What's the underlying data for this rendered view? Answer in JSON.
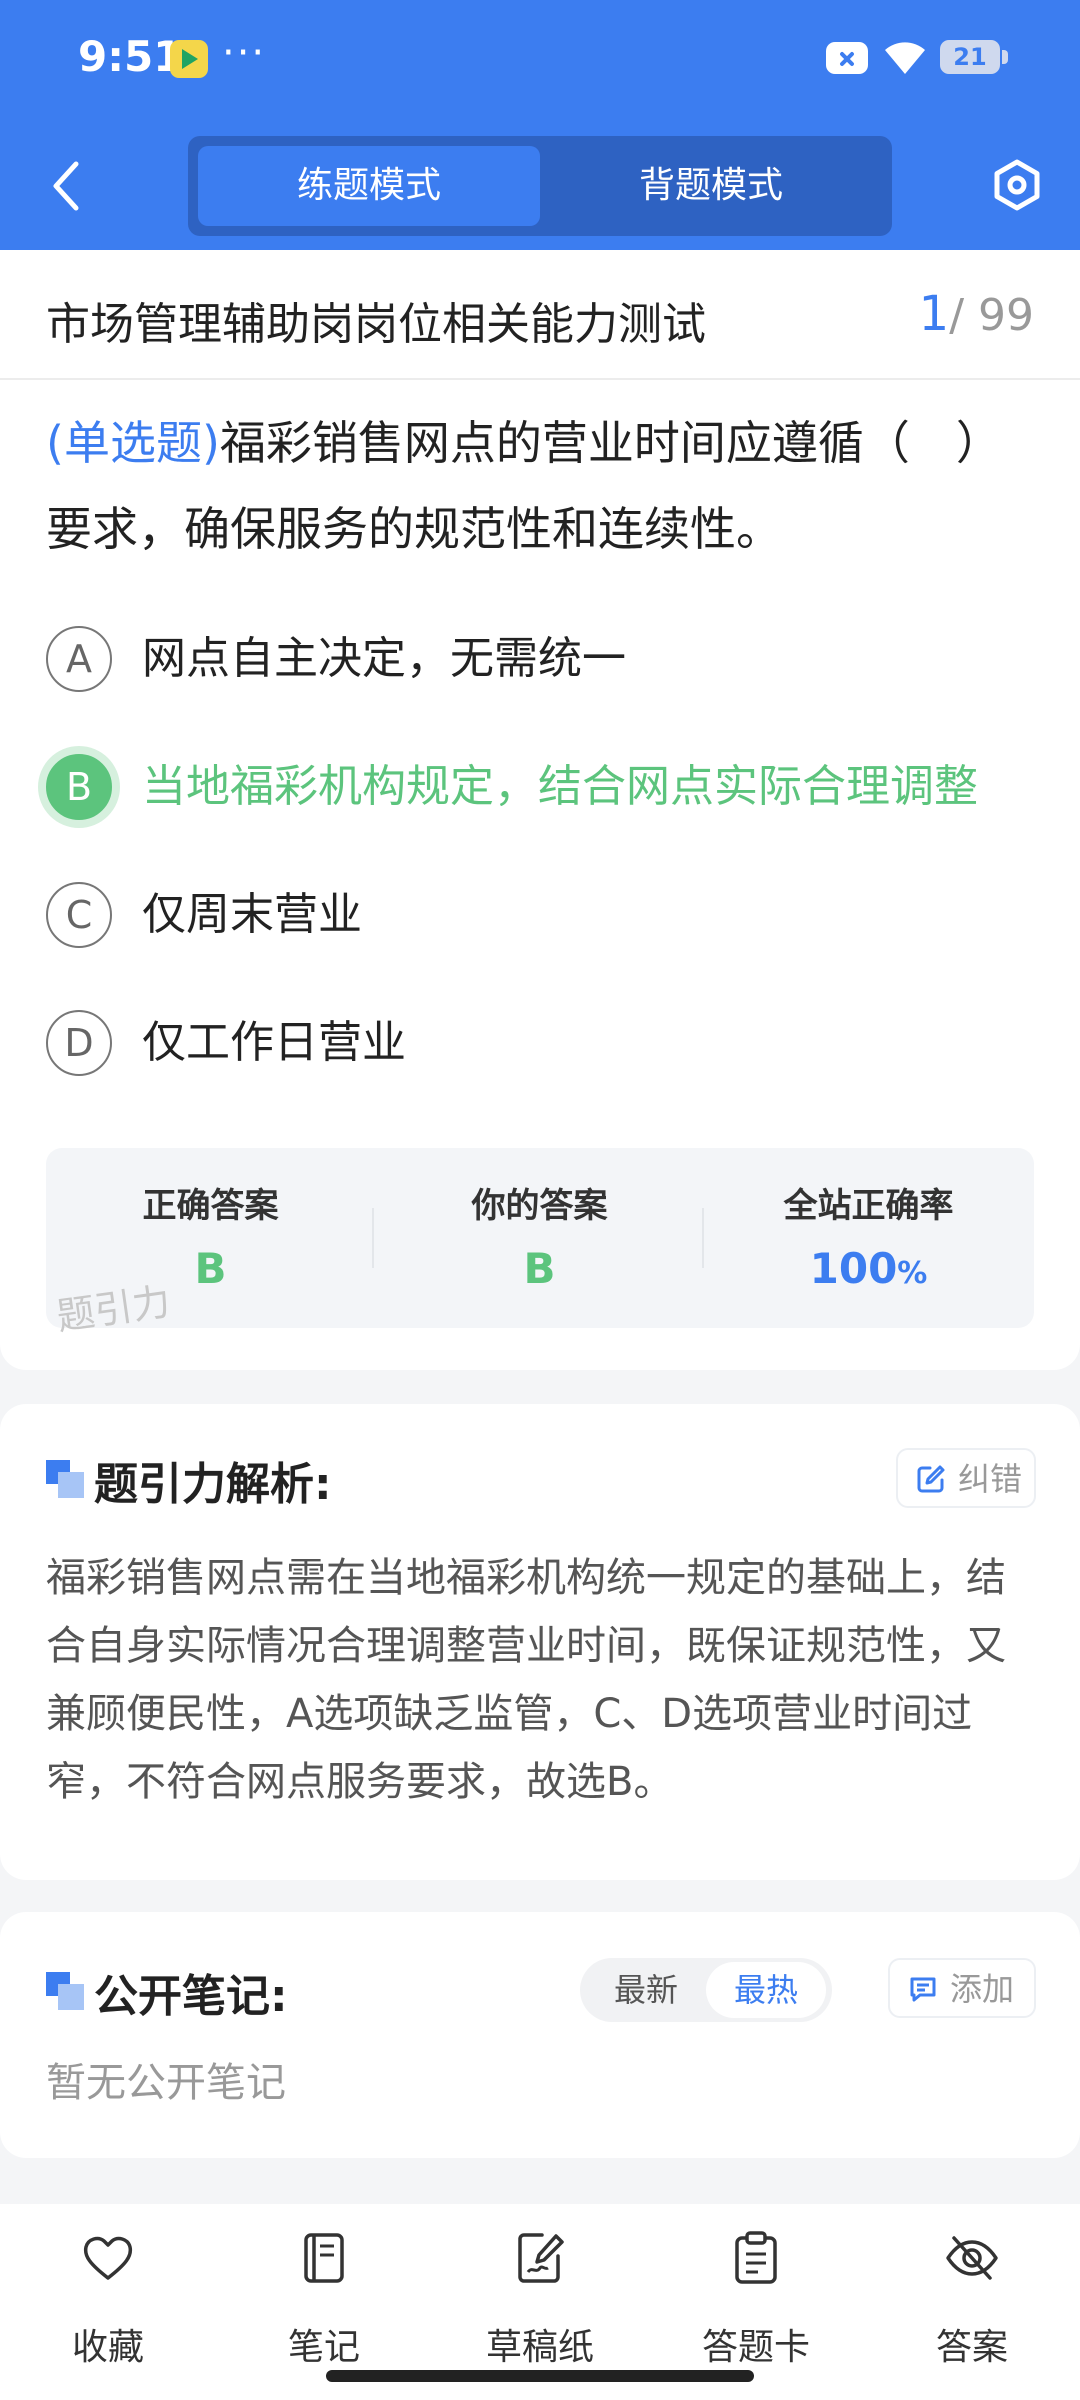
{
  "status_bar": {
    "time": "9:51",
    "dots": "···",
    "battery": "21"
  },
  "nav": {
    "tab_practice": "练题模式",
    "tab_memorize": "背题模式"
  },
  "exam": {
    "title": "市场管理辅助岗岗位相关能力测试",
    "current": "1",
    "total": "/ 99"
  },
  "question": {
    "type": "(单选题)",
    "text": "福彩销售网点的营业时间应遵循（　）要求，确保服务的规范性和连续性。",
    "options": [
      {
        "letter": "A",
        "text": "网点自主决定，无需统一"
      },
      {
        "letter": "B",
        "text": "当地福彩机构规定，结合网点实际合理调整"
      },
      {
        "letter": "C",
        "text": "仅周末营业"
      },
      {
        "letter": "D",
        "text": "仅工作日营业"
      }
    ]
  },
  "stats": {
    "correct_label": "正确答案",
    "correct_value": "B",
    "yours_label": "你的答案",
    "yours_value": "B",
    "rate_label": "全站正确率",
    "rate_value": "100",
    "rate_unit": "%",
    "watermark": "题引力"
  },
  "analysis": {
    "title": "题引力解析:",
    "report_label": "纠错",
    "text": "福彩销售网点需在当地福彩机构统一规定的基础上，结合自身实际情况合理调整营业时间，既保证规范性，又兼顾便民性，A选项缺乏监管，C、D选项营业时间过窄，不符合网点服务要求，故选B。"
  },
  "notes": {
    "title": "公开笔记:",
    "sort_latest": "最新",
    "sort_hot": "最热",
    "add_label": "添加",
    "empty_text": "暂无公开笔记"
  },
  "toolbar": {
    "favorite": "收藏",
    "notes": "笔记",
    "draft": "草稿纸",
    "answer_card": "答题卡",
    "answer": "答案"
  },
  "colors": {
    "brand": "#3c7df0",
    "correct": "#5cc47d"
  }
}
